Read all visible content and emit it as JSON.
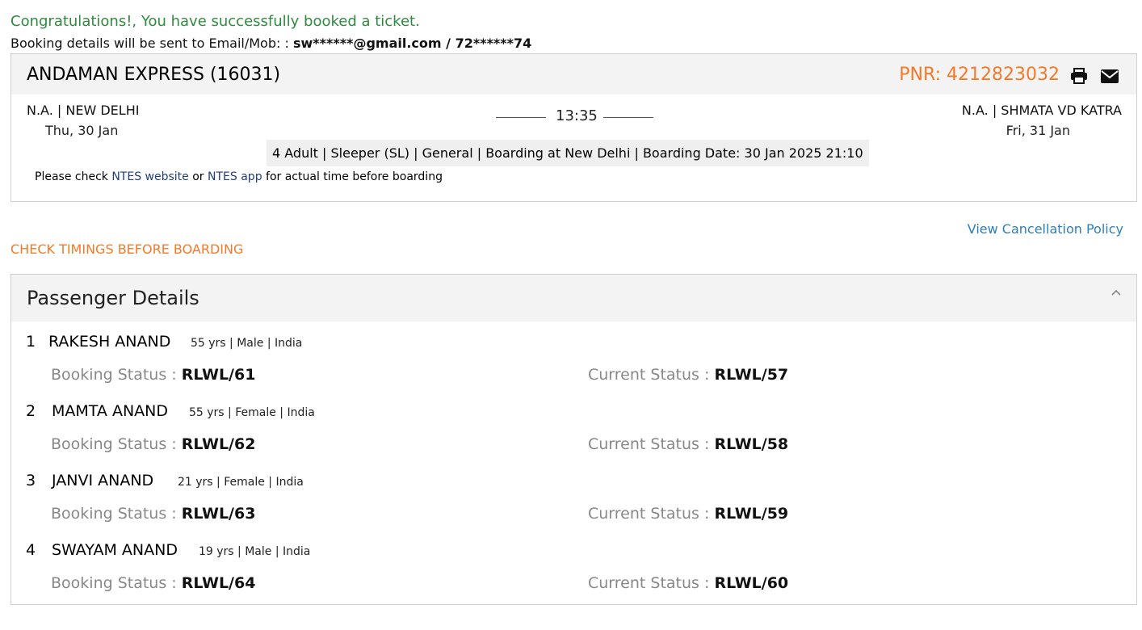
{
  "confirmation": {
    "message": "Congratulations!, You have successfully booked a ticket.",
    "sent_prefix": "Booking details will be sent to Email/Mob: : ",
    "sent_contact": "sw******@gmail.com / 72******74"
  },
  "train": {
    "name": "ANDAMAN EXPRESS (16031)",
    "pnr": "PNR: 4212823032",
    "from_station": "N.A. | NEW DELHI",
    "from_date": "Thu, 30 Jan",
    "to_station": "N.A. | SHMATA VD KATRA",
    "to_date": "Fri, 31 Jan",
    "duration": "13:35",
    "summary": "4 Adult | Sleeper (SL) | General | Boarding at New Delhi | Boarding Date: 30 Jan 2025 21:10",
    "note_prefix": "Please check ",
    "note_link1": "NTES website",
    "note_mid": " or ",
    "note_link2": "NTES app",
    "note_suffix": " for actual time before boarding",
    "icons": [
      "print-icon",
      "mail-icon"
    ],
    "accent_color": "#f47a2a"
  },
  "links": {
    "cancellation_policy": "View Cancellation Policy",
    "check_timings": "CHECK TIMINGS BEFORE BOARDING"
  },
  "passengers": {
    "title": "Passenger Details",
    "booking_label": "Booking Status : ",
    "current_label": "Current Status : ",
    "list": [
      {
        "num": "1",
        "name": "RAKESH ANAND",
        "meta": "55 yrs | Male | India",
        "booking": "RLWL/61",
        "current": "RLWL/57"
      },
      {
        "num": "2",
        "name": "MAMTA ANAND",
        "meta": "55 yrs | Female | India",
        "booking": "RLWL/62",
        "current": "RLWL/58"
      },
      {
        "num": "3",
        "name": "JANVI ANAND",
        "meta": "21 yrs | Female | India",
        "booking": "RLWL/63",
        "current": "RLWL/59"
      },
      {
        "num": "4",
        "name": "SWAYAM ANAND",
        "meta": "19 yrs | Male | India",
        "booking": "RLWL/64",
        "current": "RLWL/60"
      }
    ]
  }
}
